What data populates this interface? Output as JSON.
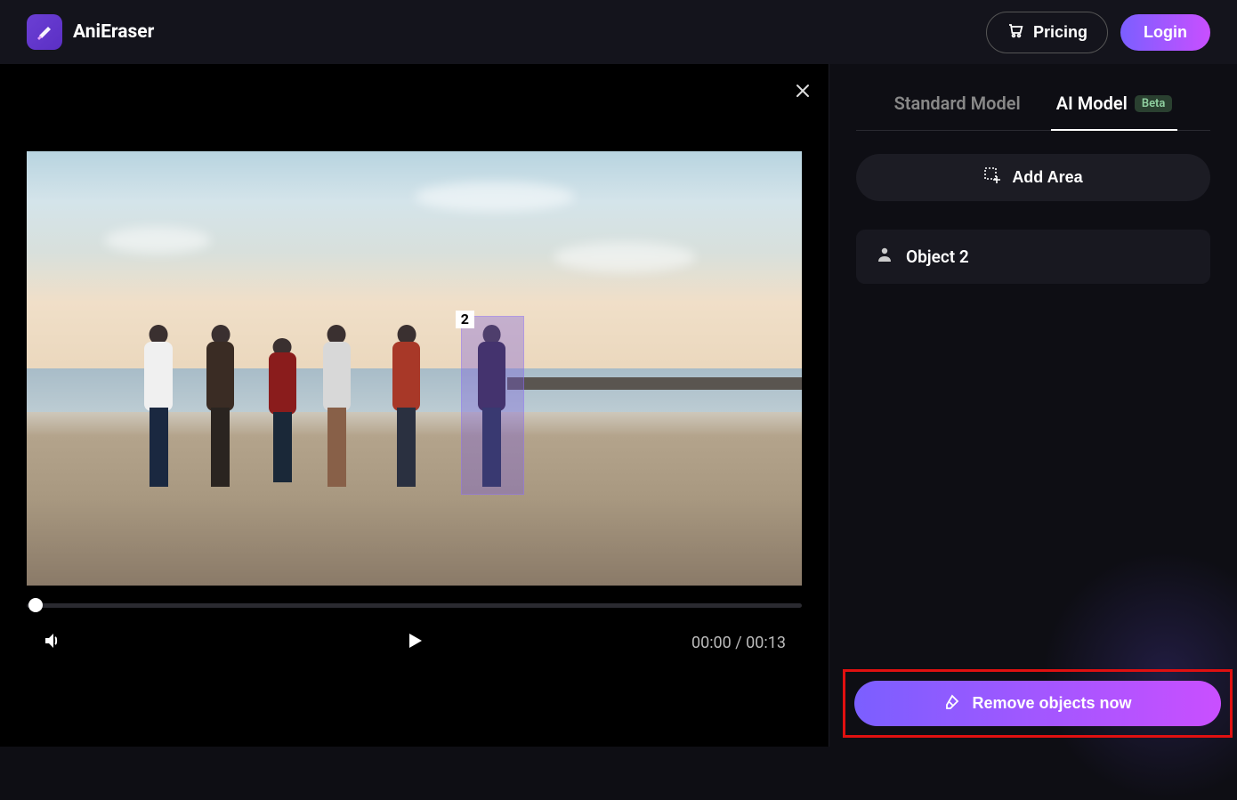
{
  "header": {
    "app_name": "AniEraser",
    "pricing_label": "Pricing",
    "login_label": "Login"
  },
  "preview": {
    "selection_number": "2",
    "time_current": "00:00",
    "time_total": "00:13"
  },
  "side": {
    "tabs": {
      "standard": "Standard Model",
      "ai": "AI Model",
      "beta_label": "Beta",
      "active": "ai"
    },
    "add_area_label": "Add Area",
    "object_label": "Object 2",
    "remove_label": "Remove objects now"
  },
  "colors": {
    "accent_gradient_start": "#7b5fff",
    "accent_gradient_end": "#c94fff",
    "highlight_border": "#e01010"
  }
}
